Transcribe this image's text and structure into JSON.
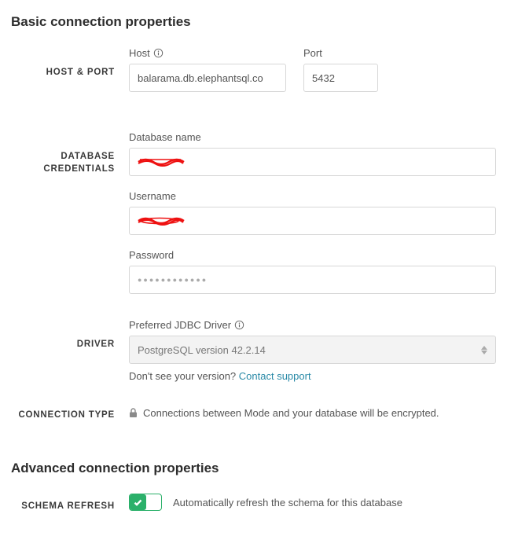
{
  "sections": {
    "basic_title": "Basic connection properties",
    "advanced_title": "Advanced connection properties"
  },
  "host_port": {
    "label": "HOST & PORT",
    "host_label": "Host",
    "host_value": "balarama.db.elephantsql.co",
    "port_label": "Port",
    "port_value": "5432"
  },
  "credentials": {
    "label": "DATABASE CREDENTIALS",
    "dbname_label": "Database name",
    "username_label": "Username",
    "password_label": "Password",
    "password_mask": "●●●●●●●●●●●●"
  },
  "driver": {
    "label": "DRIVER",
    "field_label": "Preferred JDBC Driver",
    "selected": "PostgreSQL version 42.2.14",
    "helper_prefix": "Don't see your version? ",
    "helper_link": "Contact support"
  },
  "connection_type": {
    "label": "CONNECTION TYPE",
    "text": "Connections between Mode and your database will be encrypted."
  },
  "schema_refresh": {
    "label": "SCHEMA REFRESH",
    "text": "Automatically refresh the schema for this database",
    "enabled": true
  }
}
